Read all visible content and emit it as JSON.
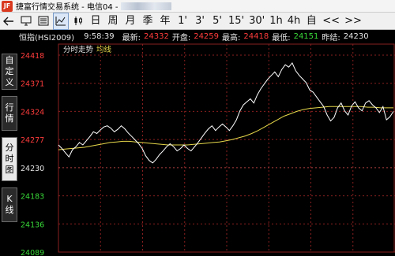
{
  "window": {
    "title": "捷富行情交易系统 - 电信04 -"
  },
  "toolbar": {
    "back_icon": "arrow-left-icon",
    "items": [
      "日",
      "周",
      "月",
      "季",
      "年",
      "1'",
      "3'",
      "5'",
      "15'",
      "30'",
      "1h",
      "4h",
      "自"
    ],
    "prev_label": "<<",
    "next_label": ">>"
  },
  "sidetabs": [
    {
      "label": "自\n定\n义"
    },
    {
      "label": "行\n情"
    },
    {
      "label": "分\n时\n图"
    },
    {
      "label": "K\n线"
    }
  ],
  "quote": {
    "name": "恒指(HSI2009)",
    "time": "9:58:39",
    "latest_label": "最新:",
    "latest": "24332",
    "open_label": "开盘:",
    "open": "24259",
    "high_label": "最高:",
    "high": "24418",
    "low_label": "最低:",
    "low": "24151",
    "prev_close_label": "昨结:",
    "prev_close": "24230"
  },
  "legend": {
    "series1": "分时走势",
    "series2": "均线"
  },
  "chart_data": {
    "type": "line",
    "y_ticks": [
      24418,
      24371,
      24324,
      24277,
      24230,
      24183,
      24136,
      24089
    ],
    "ylim": [
      24089,
      24418
    ],
    "reference": 24230,
    "colors": {
      "up": "#ff3c3c",
      "ref": "#e6e6e6",
      "down": "#38d838",
      "price": "#ffffff",
      "avg": "#e6d84a",
      "grid": "#8a1f1f"
    },
    "series": [
      {
        "name": "分时走势",
        "values": [
          24268,
          24262,
          24255,
          24248,
          24260,
          24265,
          24272,
          24268,
          24275,
          24282,
          24290,
          24287,
          24293,
          24298,
          24300,
          24296,
          24290,
          24294,
          24300,
          24295,
          24288,
          24282,
          24276,
          24270,
          24262,
          24250,
          24242,
          24238,
          24244,
          24252,
          24258,
          24265,
          24270,
          24265,
          24258,
          24262,
          24268,
          24262,
          24258,
          24265,
          24272,
          24280,
          24288,
          24295,
          24300,
          24292,
          24298,
          24303,
          24298,
          24292,
          24300,
          24310,
          24325,
          24335,
          24340,
          24345,
          24338,
          24352,
          24362,
          24370,
          24378,
          24384,
          24390,
          24382,
          24394,
          24402,
          24398,
          24405,
          24392,
          24384,
          24378,
          24372,
          24360,
          24356,
          24348,
          24340,
          24332,
          24318,
          24308,
          24314,
          24330,
          24338,
          24325,
          24318,
          24333,
          24340,
          24330,
          24325,
          24338,
          24342,
          24335,
          24330,
          24322,
          24332,
          24310,
          24315,
          24324
        ]
      },
      {
        "name": "均线",
        "values": [
          24260,
          24261,
          24262,
          24263,
          24264,
          24266,
          24268,
          24270,
          24272,
          24273,
          24274,
          24274,
          24273,
          24272,
          24271,
          24270,
          24269,
          24268,
          24268,
          24268,
          24268,
          24269,
          24270,
          24271,
          24272,
          24273,
          24275,
          24277,
          24280,
          24283,
          24287,
          24292,
          24298,
          24304,
          24310,
          24316,
          24320,
          24324,
          24327,
          24329,
          24330,
          24331,
          24332,
          24332,
          24332,
          24332,
          24332,
          24332,
          24331,
          24331,
          24330,
          24330,
          24330
        ]
      }
    ]
  }
}
